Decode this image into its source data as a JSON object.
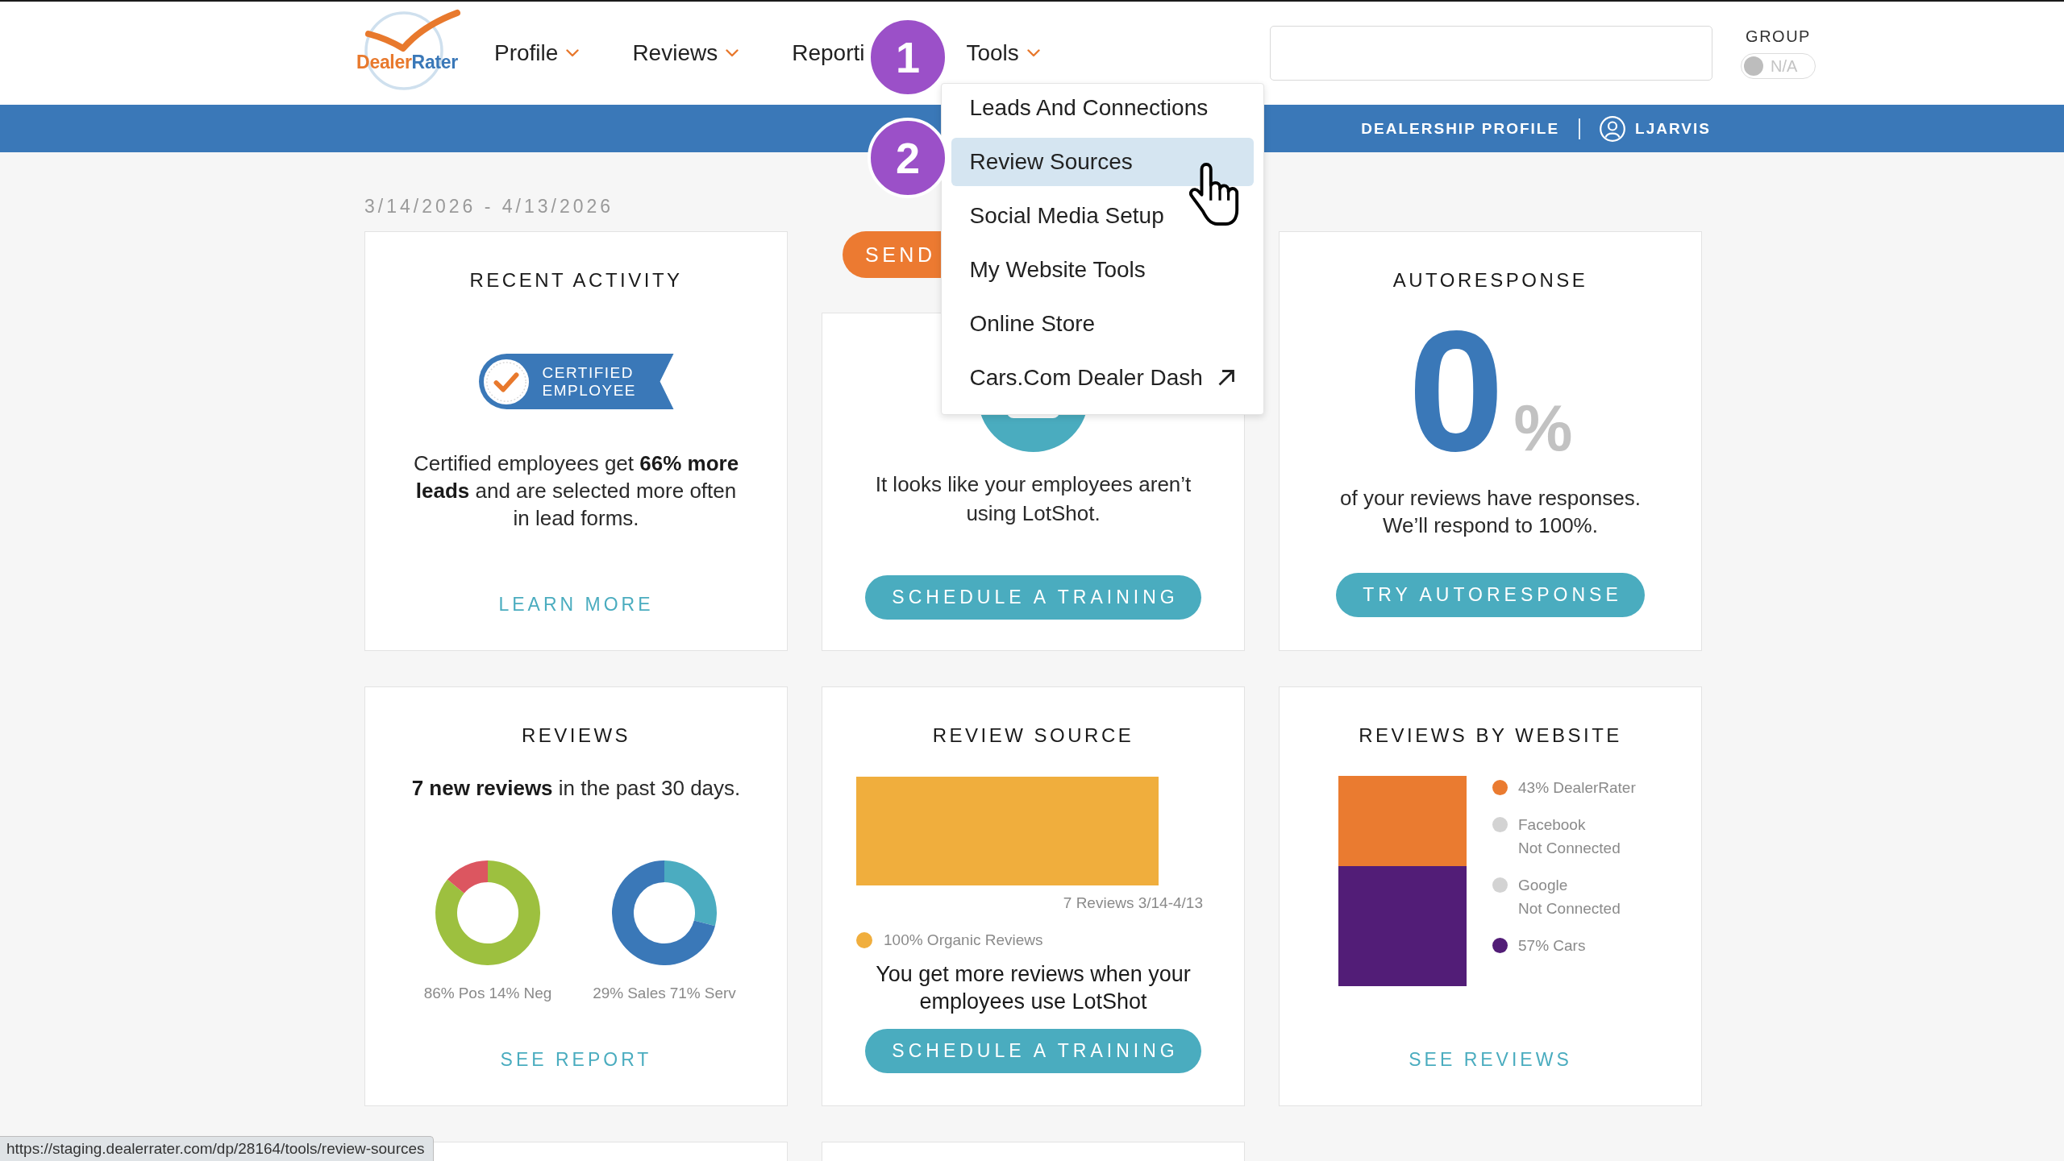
{
  "logo": {
    "first": "Dealer",
    "second": "Rater"
  },
  "nav": [
    {
      "label": "Profile",
      "caret": true
    },
    {
      "label": "Reviews",
      "caret": true
    },
    {
      "label": "Reporti",
      "caret": false
    },
    {
      "label": "Tools",
      "caret": true,
      "menu": [
        {
          "label": "Leads And Connections",
          "selected": false,
          "external": false
        },
        {
          "label": "Review Sources",
          "selected": true,
          "external": false
        },
        {
          "label": "Social Media Setup",
          "selected": false,
          "external": false
        },
        {
          "label": "My Website Tools",
          "selected": false,
          "external": false
        },
        {
          "label": "Online Store",
          "selected": false,
          "external": false
        },
        {
          "label": "Cars.Com Dealer Dash",
          "selected": false,
          "external": true
        }
      ]
    }
  ],
  "group": {
    "label": "GROUP",
    "toggle": {
      "text": "N/A",
      "on": false
    }
  },
  "account_bar": {
    "profile_link": "DEALERSHIP PROFILE",
    "user": "LJARVIS"
  },
  "date_range": "3/14/2026 - 4/13/2026",
  "cards": [
    {
      "kind": "recent_activity",
      "title": "RECENT ACTIVITY",
      "badge": "CERTIFIED EMPLOYEE",
      "text": "Certified employees get **66% more leads** and are selected more often in lead forms.",
      "link": "LEARN MORE"
    },
    {
      "kind": "lotshot",
      "send_button": "SEND",
      "text": "It looks like your employees aren’t using LotShot.",
      "button": "SCHEDULE A TRAINING"
    },
    {
      "kind": "autoresponse",
      "title": "AUTORESPONSE",
      "value": "0",
      "unit": "%",
      "text": "of your reviews have responses. We’ll respond to 100%.",
      "button": "TRY AUTORESPONSE"
    },
    {
      "kind": "reviews",
      "title": "REVIEWS",
      "text": "**7 new reviews** in the past 30 days.",
      "donuts": [
        {
          "chart_data": {
            "type": "donut",
            "categories": [
              "Pos",
              "Neg"
            ],
            "values": [
              86,
              14
            ],
            "value_labels": [
              "86%",
              "14%"
            ],
            "colors": [
              "#9dc03f",
              "#dc5660"
            ]
          }
        },
        {
          "chart_data": {
            "type": "donut",
            "categories": [
              "Sales",
              "Serv"
            ],
            "values": [
              29,
              71
            ],
            "value_labels": [
              "29%",
              "71%"
            ],
            "colors": [
              "#4bacc0",
              "#3a78b8"
            ]
          }
        }
      ],
      "link": "SEE REPORT"
    },
    {
      "kind": "review_source",
      "title": "REVIEW SOURCE",
      "caption": "7 Reviews 3/14-4/13",
      "legend": [
        {
          "label": "100% Organic Reviews",
          "color": "#f0ae3d"
        }
      ],
      "text": "You get more reviews when your employees use LotShot",
      "button": "SCHEDULE A TRAINING"
    },
    {
      "kind": "reviews_by_website",
      "title": "REVIEWS BY WEBSITE",
      "legend": [
        {
          "label": "43% DealerRater",
          "color": "#ea7b30",
          "level": 0.43
        },
        {
          "label": "Facebook",
          "note": "Not Connected",
          "color": "#d3d3d3"
        },
        {
          "label": "Google",
          "note": "Not Connected",
          "color": "#d3d3d3"
        },
        {
          "label": "57% Cars",
          "color": "#521d77",
          "level": 0.57
        }
      ],
      "link": "SEE REVIEWS"
    },
    {
      "kind": "blank"
    },
    {
      "kind": "blank"
    }
  ],
  "callouts": [
    {
      "number": "1"
    },
    {
      "number": "2"
    }
  ],
  "status_url": "https://staging.dealerrater.com/dp/28164/tools/review-sources"
}
